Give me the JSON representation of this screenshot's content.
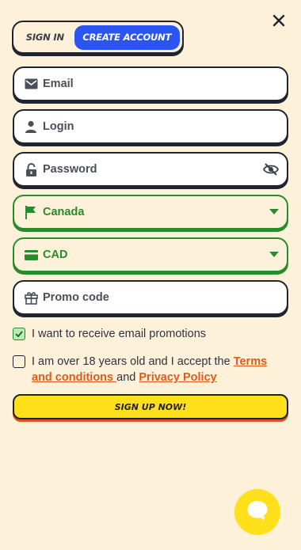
{
  "tabs": {
    "sign_in": "SIGN IN",
    "create_account": "CREATE ACCOUNT"
  },
  "fields": {
    "email": {
      "placeholder": "Email",
      "icon": "envelope-icon"
    },
    "login": {
      "placeholder": "Login",
      "icon": "user-icon"
    },
    "password": {
      "placeholder": "Password",
      "icon": "lock-icon",
      "right_icon": "eye-off-icon"
    },
    "country": {
      "value": "Canada",
      "icon": "flag-icon"
    },
    "currency": {
      "value": "CAD",
      "icon": "card-icon"
    },
    "promo": {
      "placeholder": "Promo code",
      "icon": "gift-icon"
    }
  },
  "checks": {
    "promotions": {
      "label": "I want to receive email promotions",
      "checked": true
    },
    "terms": {
      "text_before": "I am over 18 years old and I accept the ",
      "terms_link": "Terms and conditions ",
      "text_middle": "and ",
      "privacy_link": "Privacy Policy",
      "checked": false
    }
  },
  "submit_label": "SIGN UP NOW!",
  "colors": {
    "accent_blue": "#2b55f2",
    "green": "#2b8a2b",
    "yellow": "#ffe01a",
    "link_orange": "#e05a1a",
    "background": "#fdf1da"
  }
}
